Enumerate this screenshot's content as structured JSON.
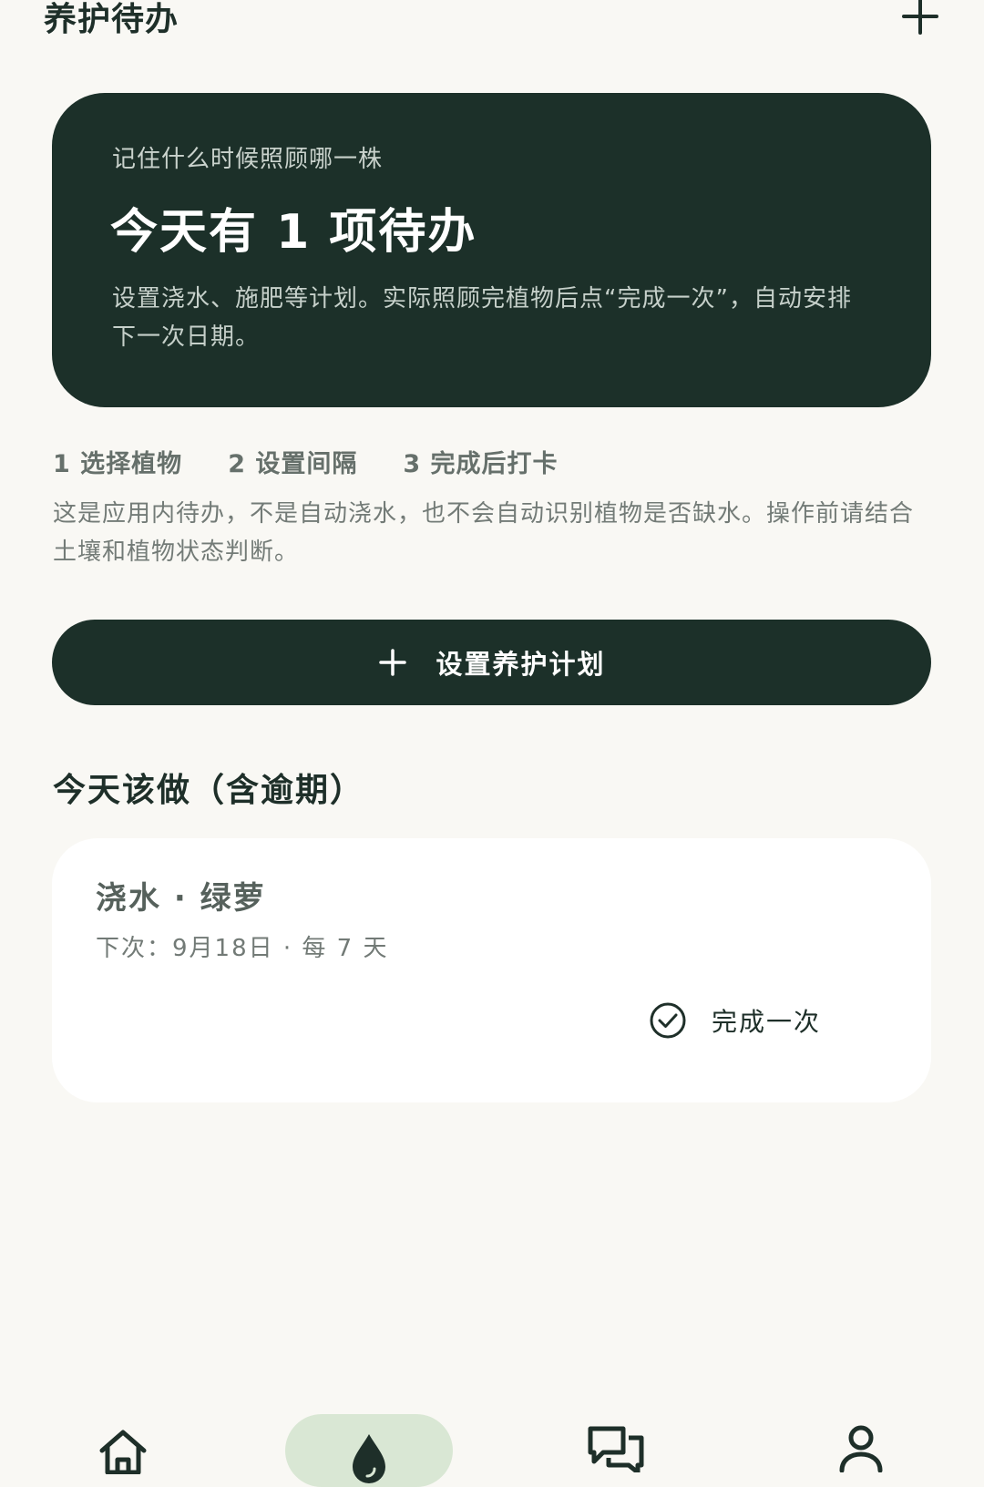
{
  "header": {
    "title": "养护待办",
    "add_icon": "plus-icon"
  },
  "hero": {
    "eyebrow": "记住什么时候照顾哪一株",
    "title": "今天有 1 项待办",
    "description": "设置浇水、施肥等计划。实际照顾完植物后点“完成一次”，自动安排下一次日期。"
  },
  "steps": {
    "items": [
      "1 选择植物",
      "2 设置间隔",
      "3 完成后打卡"
    ]
  },
  "note": "这是应用内待办，不是自动浇水，也不会自动识别植物是否缺水。操作前请结合土壤和植物状态判断。",
  "primary_action": {
    "label": "设置养护计划",
    "icon": "plus-icon"
  },
  "section": {
    "title": "今天该做（含逾期）"
  },
  "tasks": [
    {
      "title": "浇水 · 绿萝",
      "meta": "下次：9月18日 · 每 7 天",
      "complete_label": "完成一次",
      "complete_icon": "check-circle-icon"
    }
  ],
  "bottom_nav": {
    "items": [
      {
        "icon": "home-icon",
        "active": false
      },
      {
        "icon": "drop-icon",
        "active": true
      },
      {
        "icon": "chat-icon",
        "active": false
      },
      {
        "icon": "user-icon",
        "active": false
      }
    ]
  },
  "colors": {
    "background": "#f9f8f4",
    "dark_green": "#1c3029",
    "active_nav_bg": "#d9e7d4",
    "card_bg": "#ffffff"
  }
}
